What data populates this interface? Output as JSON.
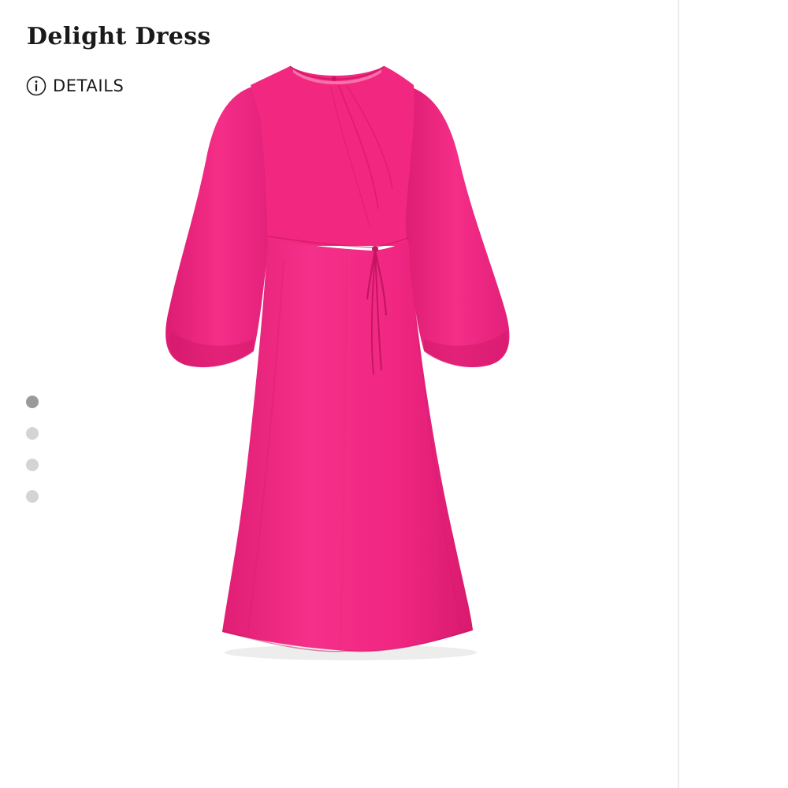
{
  "product": {
    "name": "Delight Dress",
    "details_label": "DETAILS",
    "color": "#f0247f",
    "icons": {
      "details": "info-icon"
    }
  },
  "gallery": {
    "image_count": 4,
    "active_index": 0,
    "active_dot_color": "#9a9a9a",
    "inactive_dot_color": "#d4d4d4"
  }
}
